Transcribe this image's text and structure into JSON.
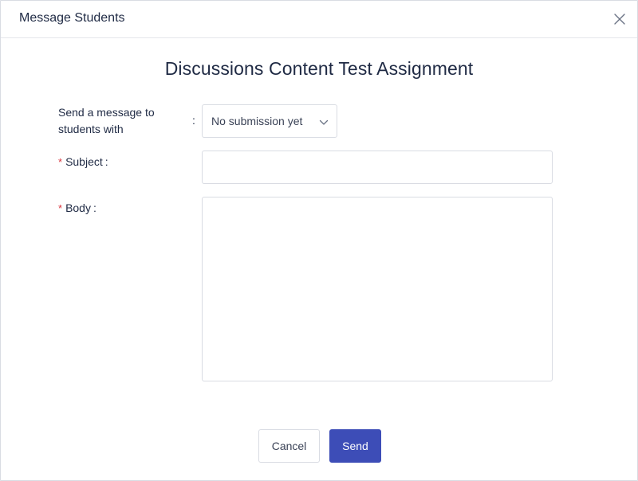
{
  "modal": {
    "title": "Message Students",
    "close_icon": "close-icon"
  },
  "assignment_title": "Discussions Content Test Assignment",
  "form": {
    "filter": {
      "label_line1": "Send a message to",
      "label_line2": "students with",
      "colon": ":",
      "selected": "No submission yet",
      "icon": "chevron-down-icon"
    },
    "subject": {
      "required_mark": "*",
      "label": "Subject",
      "colon": ":",
      "value": ""
    },
    "body": {
      "required_mark": "*",
      "label": "Body",
      "colon": ":",
      "value": ""
    }
  },
  "footer": {
    "cancel_label": "Cancel",
    "send_label": "Send"
  },
  "colors": {
    "primary": "#3d4db7",
    "required": "#d9363e",
    "text": "#1f2a44",
    "border": "#d9dce3"
  }
}
